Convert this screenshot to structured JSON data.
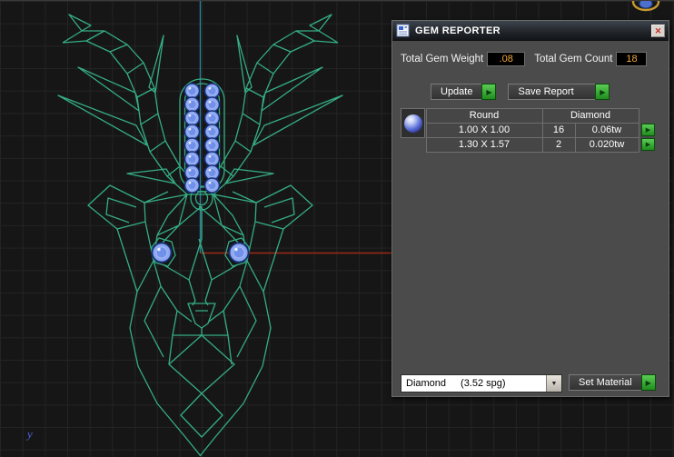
{
  "viewport": {
    "axis_label": "y"
  },
  "gem_reporter": {
    "title": "GEM REPORTER",
    "total_weight_label": "Total Gem Weight",
    "total_weight_value": ".08",
    "total_count_label": "Total Gem Count",
    "total_count_value": "18",
    "update_button": "Update",
    "save_report_button": "Save Report",
    "table": {
      "shape_header": "Round",
      "material_header": "Diamond",
      "rows": [
        {
          "size": "1.00 X 1.00",
          "count": "16",
          "weight": "0.06tw"
        },
        {
          "size": "1.30 X 1.57",
          "count": "2",
          "weight": "0.020tw"
        }
      ]
    },
    "material_name": "Diamond",
    "material_spg": "(3.52 spg)",
    "set_material_button": "Set Material"
  },
  "icons": {
    "close": "✕",
    "dropdown_arrow": "▼",
    "run_arrow": "▶"
  },
  "colors": {
    "wireframe_green": "#35ad85",
    "gem_blue": "#8ea8f0",
    "value_orange": "#f4a83a",
    "button_green": "#2f9e2f",
    "axis_red": "#a02a18",
    "axis_blue": "#2b7d9e"
  }
}
